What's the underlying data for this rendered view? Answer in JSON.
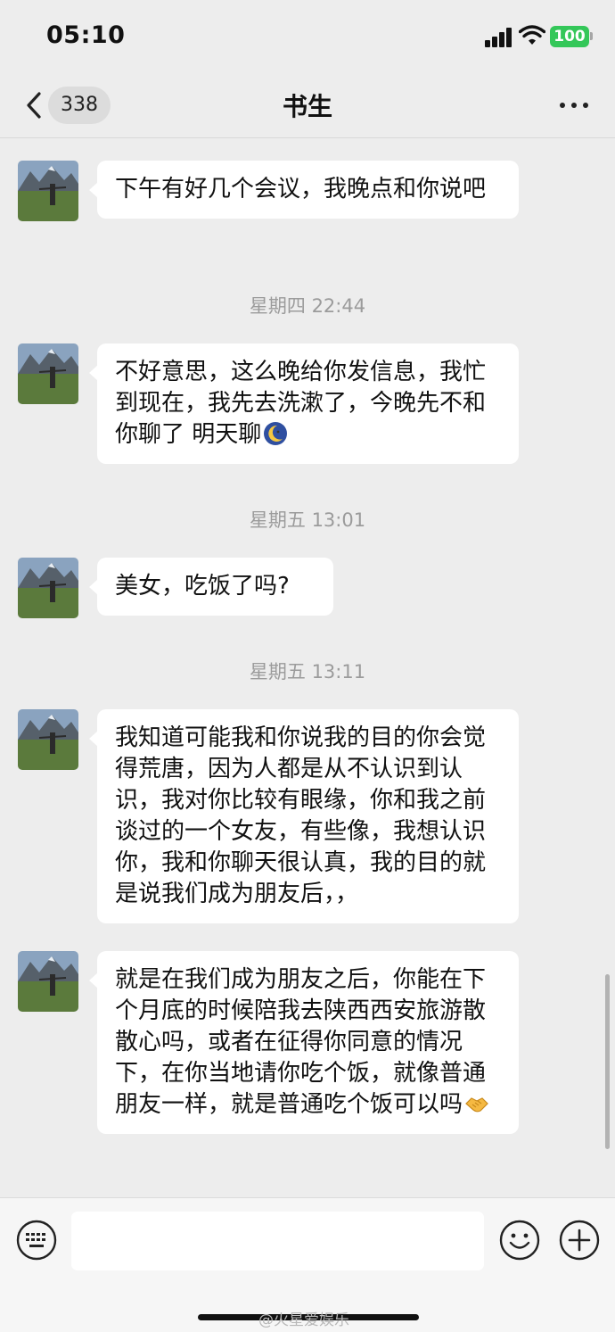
{
  "status_bar": {
    "time": "05:10",
    "battery": "100"
  },
  "nav": {
    "unread_count": "338",
    "title": "书生"
  },
  "messages": [
    {
      "text": "下午有好几个会议，我晚点和你说吧"
    },
    {
      "text": "不好意思，这么晚给你发信息，我忙到现在，我先去洗漱了，今晚先不和你聊了  明天聊",
      "emoji": "moon-face-emoji"
    },
    {
      "text": "美女，吃饭了吗?"
    },
    {
      "text": "我知道可能我和你说我的目的你会觉得荒唐，因为人都是从不认识到认识，我对你比较有眼缘，你和我之前谈过的一个女友，有些像，我想认识你，我和你聊天很认真，我的目的就是说我们成为朋友后，，"
    },
    {
      "text": "就是在我们成为朋友之后，你能在下个月底的时候陪我去陕西西安旅游散散心吗，或者在征得你同意的情况下，在你当地请你吃个饭，就像普通朋友一样，就是普通吃个饭可以吗",
      "emoji": "handshake-emoji"
    }
  ],
  "timestamps": [
    "星期四 22:44",
    "星期五 13:01",
    "星期五 13:11"
  ],
  "input": {
    "value": ""
  },
  "watermark": "@火星爱娱乐",
  "colors": {
    "background": "#ededed",
    "bubble": "#ffffff",
    "battery": "#34c759",
    "timestamp": "#9b9b9b"
  }
}
